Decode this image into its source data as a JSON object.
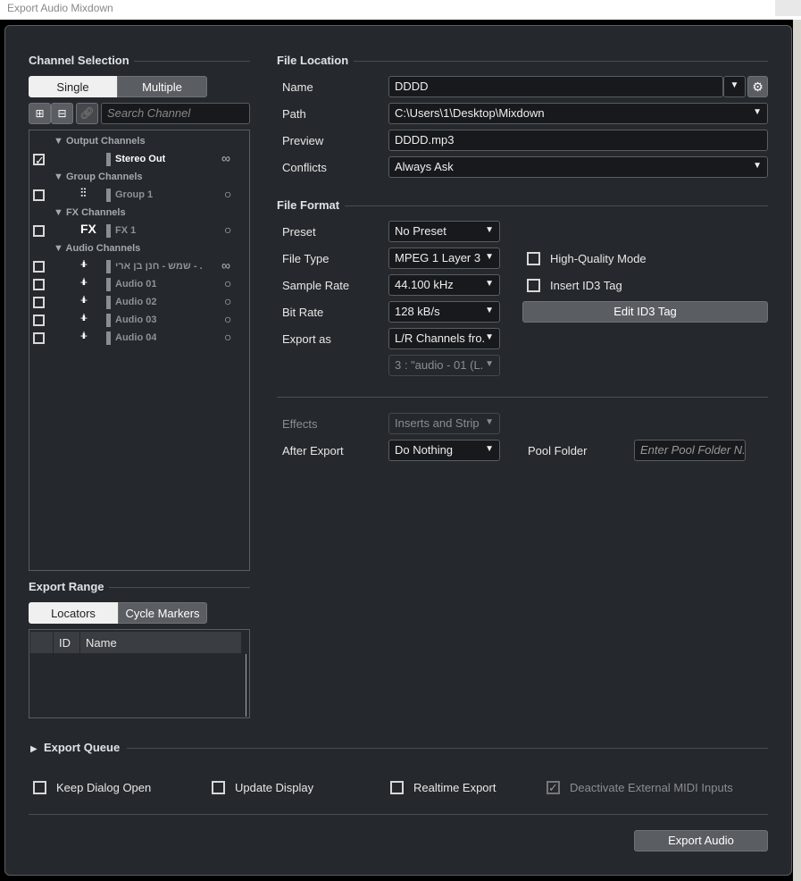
{
  "window": {
    "title": "Export Audio Mixdown"
  },
  "channel_selection": {
    "title": "Channel Selection",
    "modes": [
      "Single",
      "Multiple"
    ],
    "search_placeholder": "Search Channel",
    "groups": [
      {
        "label": "Output Channels",
        "items": [
          {
            "name": "Stereo Out",
            "checked": true,
            "icon": "none",
            "type": "stereo"
          }
        ]
      },
      {
        "label": "Group Channels",
        "items": [
          {
            "name": "Group 1",
            "checked": false,
            "icon": "group-icon",
            "type": "mono"
          }
        ]
      },
      {
        "label": "FX Channels",
        "items": [
          {
            "name": "FX 1",
            "checked": false,
            "icon": "FX",
            "type": "mono"
          }
        ]
      },
      {
        "label": "Audio Channels",
        "items": [
          {
            "name": "שמש - חנן בן ארי - .",
            "checked": false,
            "icon": "waveform-icon",
            "type": "stereo"
          },
          {
            "name": "Audio 01",
            "checked": false,
            "icon": "waveform-icon",
            "type": "mono"
          },
          {
            "name": "Audio 02",
            "checked": false,
            "icon": "waveform-icon",
            "type": "mono"
          },
          {
            "name": "Audio 03",
            "checked": false,
            "icon": "waveform-icon",
            "type": "mono"
          },
          {
            "name": "Audio 04",
            "checked": false,
            "icon": "waveform-icon",
            "type": "mono"
          }
        ]
      }
    ]
  },
  "export_range": {
    "title": "Export Range",
    "modes": [
      "Locators",
      "Cycle Markers"
    ],
    "columns": [
      "ID",
      "Name"
    ]
  },
  "file_location": {
    "title": "File Location",
    "name_label": "Name",
    "name": "DDDD",
    "path_label": "Path",
    "path": "C:\\Users\\1\\Desktop\\Mixdown",
    "preview_label": "Preview",
    "preview": "DDDD.mp3",
    "conflicts_label": "Conflicts",
    "conflicts": "Always Ask"
  },
  "file_format": {
    "title": "File Format",
    "preset_label": "Preset",
    "preset": "No Preset",
    "file_type_label": "File Type",
    "file_type": "MPEG 1 Layer 3",
    "sample_rate_label": "Sample Rate",
    "sample_rate": "44.100 kHz",
    "bit_rate_label": "Bit Rate",
    "bit_rate": "128 kB/s",
    "export_as_label": "Export as",
    "export_as": "L/R Channels fro.",
    "export_sub": "3 : \"audio - 01 (L.",
    "hq_label": "High-Quality Mode",
    "id3_label": "Insert ID3 Tag",
    "edit_id3": "Edit ID3 Tag"
  },
  "post": {
    "effects_label": "Effects",
    "effects": "Inserts and Strip",
    "after_export_label": "After Export",
    "after_export": "Do Nothing",
    "pool_folder_label": "Pool Folder",
    "pool_folder_placeholder": "Enter Pool Folder N."
  },
  "queue": {
    "title": "Export Queue"
  },
  "options": [
    {
      "label": "Keep Dialog Open",
      "checked": false
    },
    {
      "label": "Update Display",
      "checked": false
    },
    {
      "label": "Realtime Export",
      "checked": false
    },
    {
      "label": "Deactivate External MIDI Inputs",
      "checked": true,
      "disabled": true
    }
  ],
  "export_button": "Export Audio"
}
